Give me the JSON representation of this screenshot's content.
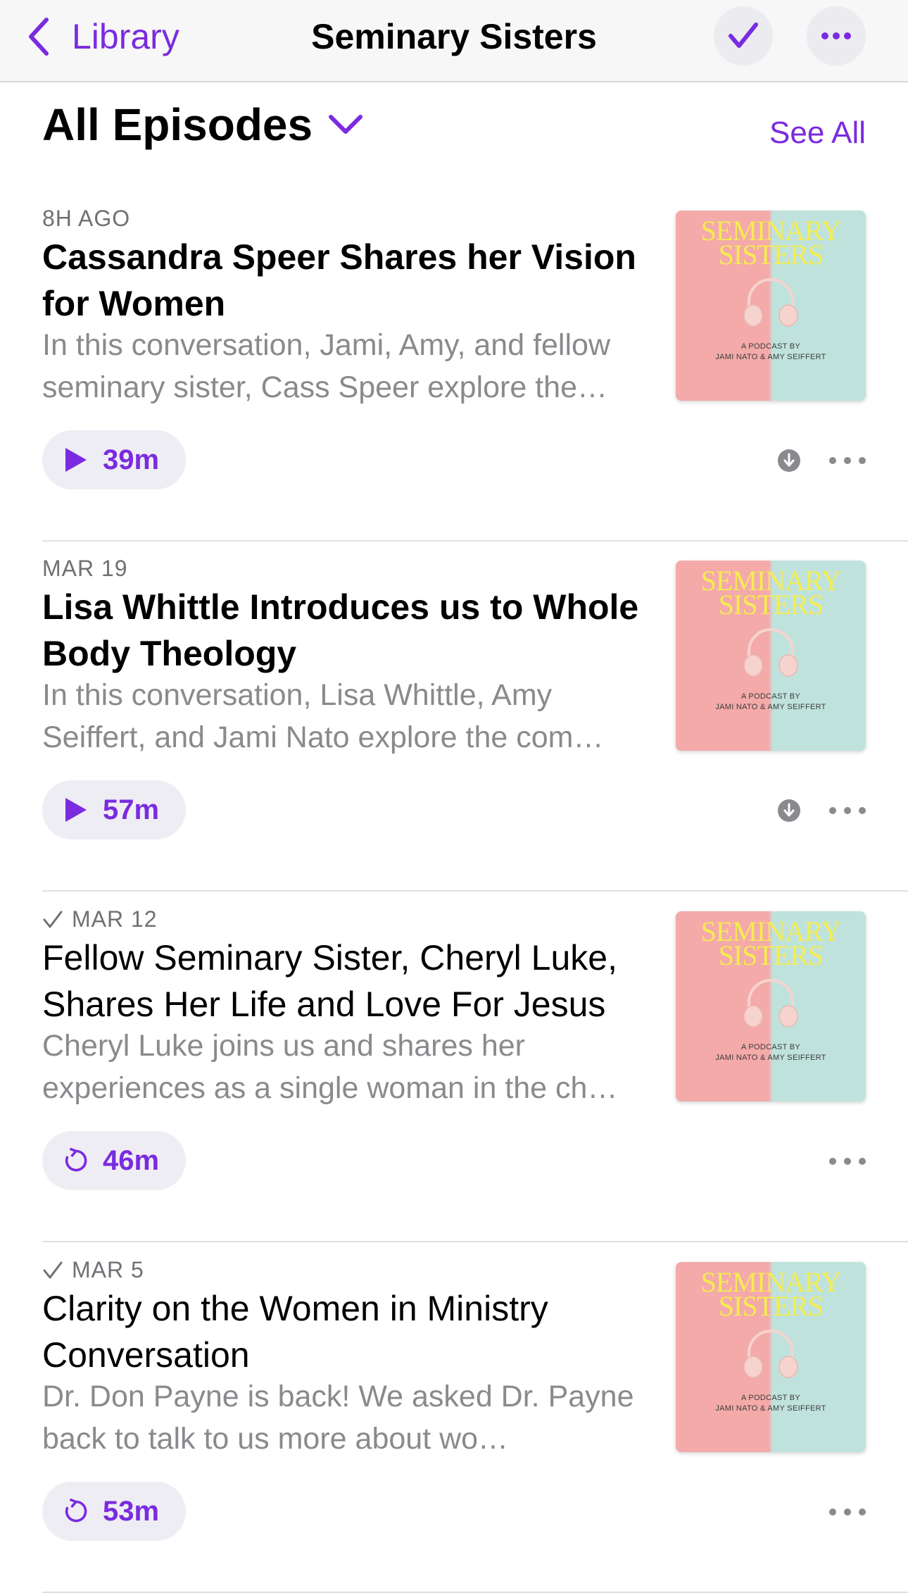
{
  "nav": {
    "back_label": "Library",
    "title": "Seminary Sisters"
  },
  "section": {
    "title": "All Episodes",
    "see_all": "See All"
  },
  "artwork": {
    "title_line1": "SEMINARY",
    "title_line2": "SISTERS",
    "subtitle_line1": "A PODCAST BY",
    "subtitle_line2": "JAMI NATO & AMY SEIFFERT"
  },
  "episodes": [
    {
      "date": "8H AGO",
      "played": false,
      "title": "Cassandra Speer Shares her Vision for Women",
      "description": "In this conversation, Jami, Amy, and fellow seminary sister, Cass Speer explore the…",
      "duration": "39m",
      "action_icon": "play-icon",
      "downloadable": true
    },
    {
      "date": "MAR 19",
      "played": false,
      "title": "Lisa Whittle Introduces us to Whole Body Theology",
      "description": "In this conversation, Lisa Whittle, Amy Seiffert, and Jami Nato explore the com…",
      "duration": "57m",
      "action_icon": "play-icon",
      "downloadable": true
    },
    {
      "date": "MAR 12",
      "played": true,
      "title": "Fellow Seminary Sister, Cheryl Luke, Shares Her Life and Love For Jesus",
      "description": "Cheryl Luke joins us and shares her experiences as a single woman in the ch…",
      "duration": "46m",
      "action_icon": "replay-icon",
      "downloadable": false
    },
    {
      "date": "MAR 5",
      "played": true,
      "title": "Clarity on the Women in Ministry Conversation",
      "description": "Dr. Don Payne is back! We asked Dr. Payne back to talk to us more about wo…",
      "duration": "53m",
      "action_icon": "replay-icon",
      "downloadable": false
    }
  ],
  "colors": {
    "accent": "#7a2be0",
    "secondary_text": "#8a8a8e",
    "date_text": "#6f6f74"
  }
}
